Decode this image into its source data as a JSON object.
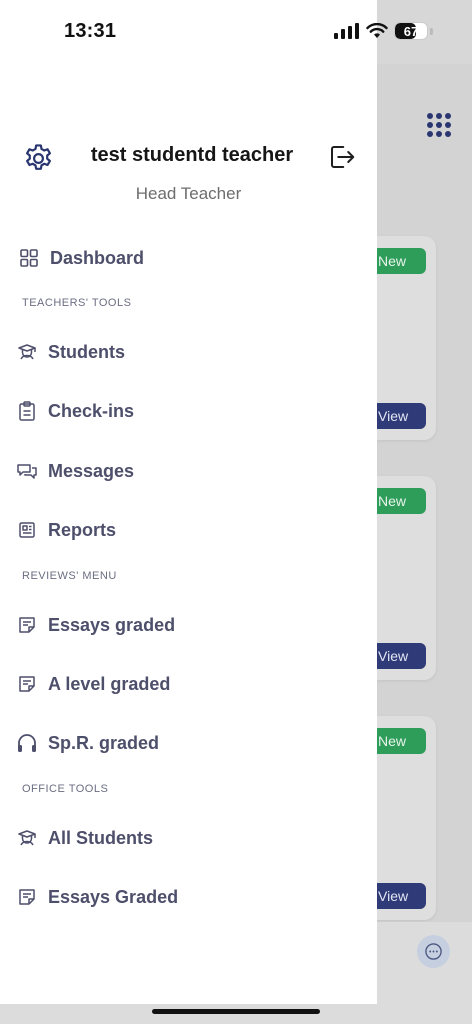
{
  "status_bar": {
    "time": "13:31",
    "battery": "67",
    "battery_level": 0.67
  },
  "drawer": {
    "user_name": "test studentd teacher",
    "user_role": "Head Teacher",
    "dashboard": {
      "label": "Dashboard",
      "icon": "grid-icon"
    },
    "sections": [
      {
        "title": "TEACHERS' TOOLS",
        "items": [
          {
            "label": "Students",
            "icon": "graduate-icon"
          },
          {
            "label": "Check-ins",
            "icon": "clipboard-icon"
          },
          {
            "label": "Messages",
            "icon": "chat-bubbles-icon"
          },
          {
            "label": "Reports",
            "icon": "newspaper-icon"
          }
        ]
      },
      {
        "title": "REVIEWS' MENU",
        "items": [
          {
            "label": "Essays graded",
            "icon": "note-icon"
          },
          {
            "label": "A level graded",
            "icon": "note-icon"
          },
          {
            "label": "Sp.R. graded",
            "icon": "headphones-icon"
          }
        ]
      },
      {
        "title": "OFFICE TOOLS",
        "items": [
          {
            "label": "All Students",
            "icon": "graduate-icon"
          },
          {
            "label": "Essays Graded",
            "icon": "note-icon"
          }
        ]
      }
    ]
  },
  "background": {
    "cards": [
      {
        "badge": "New",
        "button": "View"
      },
      {
        "badge": "New",
        "button": "View"
      },
      {
        "badge": "New",
        "button": "View"
      }
    ]
  },
  "colors": {
    "accent": "#2e3b78",
    "new_badge": "#2f9d5a",
    "nav_text": "#4d4f6b"
  }
}
